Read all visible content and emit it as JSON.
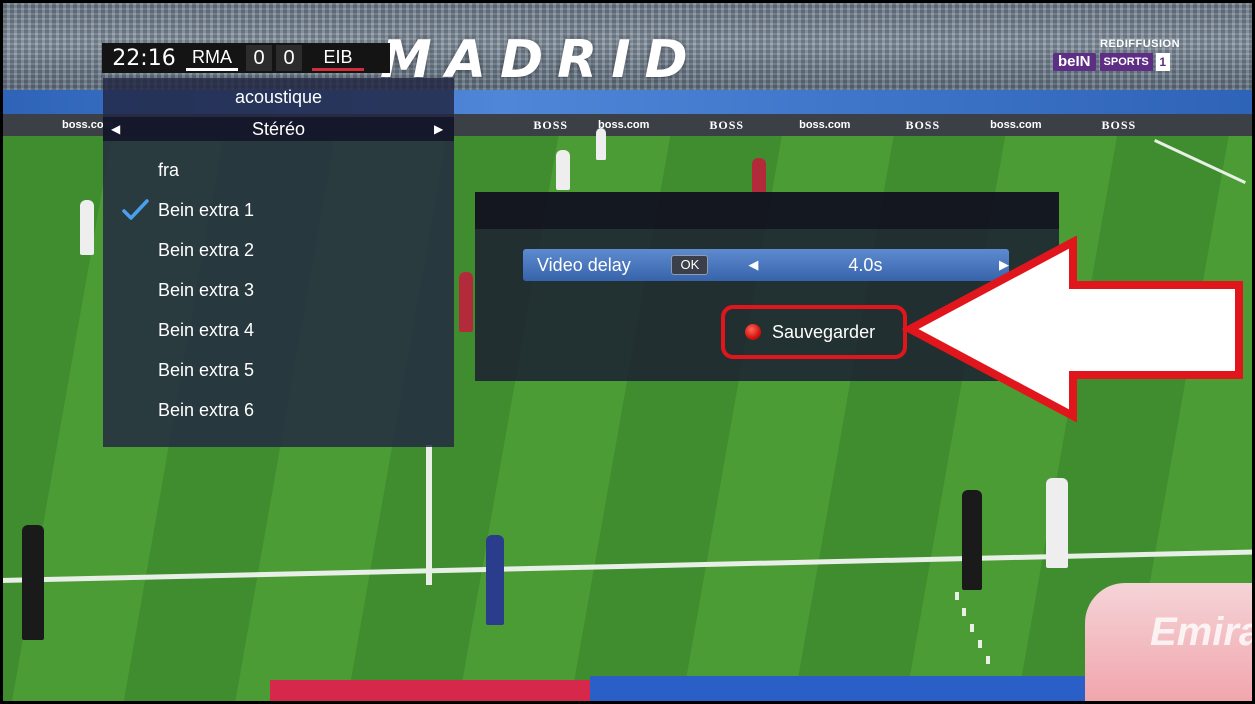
{
  "scoreboard": {
    "time": "22:16",
    "home_team": "RMA",
    "home_score": "0",
    "away_score": "0",
    "away_team": "EIB"
  },
  "broadcaster": {
    "tag": "REDIFFUSION",
    "logo": "beIN",
    "channel": "SPORTS",
    "number": "1"
  },
  "stadium": {
    "banner": "MADRID",
    "ads": [
      "boss.com",
      "BOSS",
      "boss.com",
      "BOSS",
      "boss.com",
      "BOSS",
      "boss.com",
      "BOSS"
    ],
    "bench_text": "Emira"
  },
  "audio_menu": {
    "title": "acoustique",
    "mode": "Stéréo",
    "left_arrow_icon": "triangle-left-icon",
    "right_arrow_icon": "triangle-right-icon",
    "selected_index": 1,
    "tracks": [
      "fra",
      "Bein extra 1",
      "Bein extra 2",
      "Bein extra 3",
      "Bein extra 4",
      "Bein extra 5",
      "Bein extra 6"
    ],
    "check_color": "#4aa0f0"
  },
  "video_delay": {
    "label": "Video delay",
    "ok_label": "OK",
    "value": "4.0s",
    "save_label": "Sauvegarder",
    "save_dot_color": "#d4120f"
  },
  "annotation": {
    "highlight_color": "#e1161c",
    "arrow_icon": "arrow-left-icon"
  }
}
